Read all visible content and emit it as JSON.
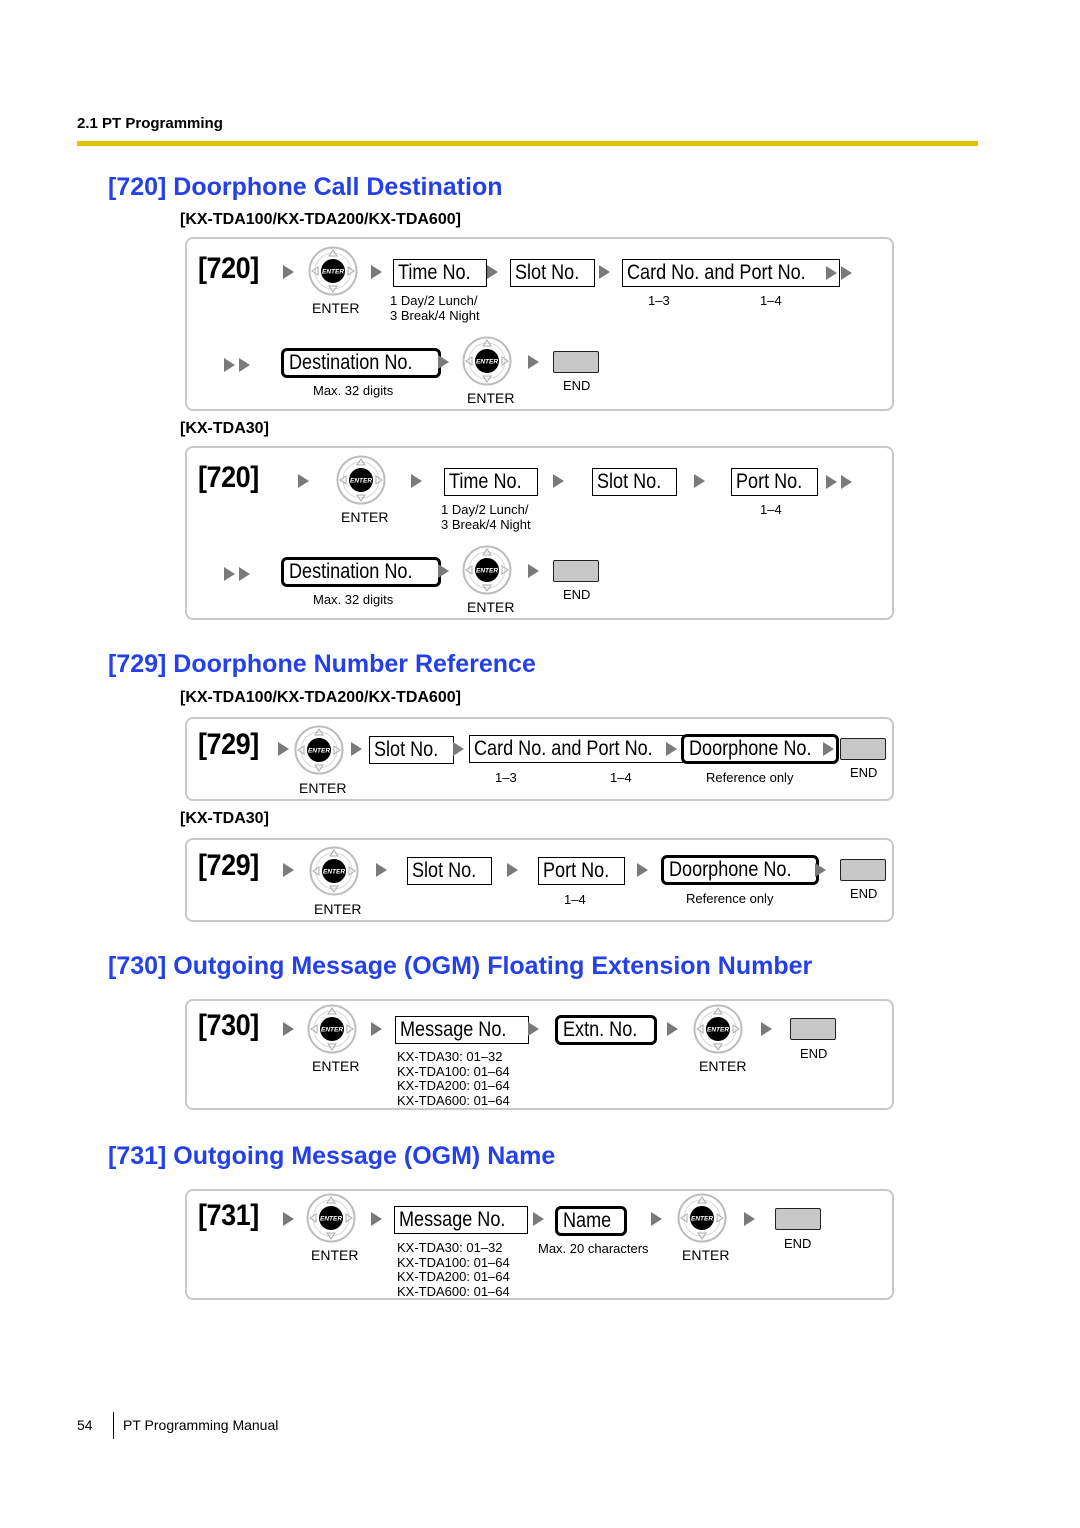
{
  "header": {
    "running_title": "2.1 PT Programming"
  },
  "colors": {
    "title_blue": "#2440e8",
    "rule_yellow": "#e0c400",
    "end_key_gray": "#c8c8c8"
  },
  "icons": {
    "enter": "enter-key-icon",
    "arrow": "right-arrow-icon",
    "double_arrow": "double-right-arrow-icon",
    "end": "end-key-icon"
  },
  "sections": {
    "s720": {
      "title": "[720] Doorphone Call Destination",
      "model_a": "[KX-TDA100/KX-TDA200/KX-TDA600]",
      "model_b": "[KX-TDA30]",
      "panel_a": {
        "code": "[720]",
        "enter": "ENTER",
        "time_no": "Time No.",
        "time_hint1": "1 Day/2 Lunch/",
        "time_hint2": "3 Break/4 Night",
        "slot_no": "Slot No.",
        "card_port": "Card No. and Port No.",
        "card_range": "1–3",
        "port_range": "1–4",
        "destination": "Destination No.",
        "dest_hint": "Max. 32 digits",
        "enter2": "ENTER",
        "end": "END"
      },
      "panel_b": {
        "code": "[720]",
        "enter": "ENTER",
        "time_no": "Time No.",
        "time_hint1": "1 Day/2 Lunch/",
        "time_hint2": "3 Break/4 Night",
        "slot_no": "Slot No.",
        "port_no": "Port No.",
        "port_range": "1–4",
        "destination": "Destination No.",
        "dest_hint": "Max. 32 digits",
        "enter2": "ENTER",
        "end": "END"
      }
    },
    "s729": {
      "title": "[729] Doorphone Number Reference",
      "model_a": "[KX-TDA100/KX-TDA200/KX-TDA600]",
      "model_b": "[KX-TDA30]",
      "panel_a": {
        "code": "[729]",
        "enter": "ENTER",
        "slot_no": "Slot No.",
        "card_port": "Card No. and Port No.",
        "card_range": "1–3",
        "port_range": "1–4",
        "doorphone": "Doorphone No.",
        "door_hint": "Reference only",
        "end": "END"
      },
      "panel_b": {
        "code": "[729]",
        "enter": "ENTER",
        "slot_no": "Slot No.",
        "port_no": "Port No.",
        "port_range": "1–4",
        "doorphone": "Doorphone No.",
        "door_hint": "Reference only",
        "end": "END"
      }
    },
    "s730": {
      "title": "[730] Outgoing Message (OGM) Floating Extension Number",
      "panel": {
        "code": "[730]",
        "enter": "ENTER",
        "message_no": "Message No.",
        "ranges": [
          "KX-TDA30: 01–32",
          "KX-TDA100: 01–64",
          "KX-TDA200: 01–64",
          "KX-TDA600: 01–64"
        ],
        "extn_no": "Extn. No.",
        "enter2": "ENTER",
        "end": "END"
      }
    },
    "s731": {
      "title": "[731] Outgoing Message (OGM) Name",
      "panel": {
        "code": "[731]",
        "enter": "ENTER",
        "message_no": "Message No.",
        "ranges": [
          "KX-TDA30: 01–32",
          "KX-TDA100: 01–64",
          "KX-TDA200: 01–64",
          "KX-TDA600: 01–64"
        ],
        "name": "Name",
        "name_hint": "Max. 20 characters",
        "enter2": "ENTER",
        "end": "END"
      }
    }
  },
  "footer": {
    "page_number": "54",
    "manual_title": "PT Programming Manual"
  }
}
